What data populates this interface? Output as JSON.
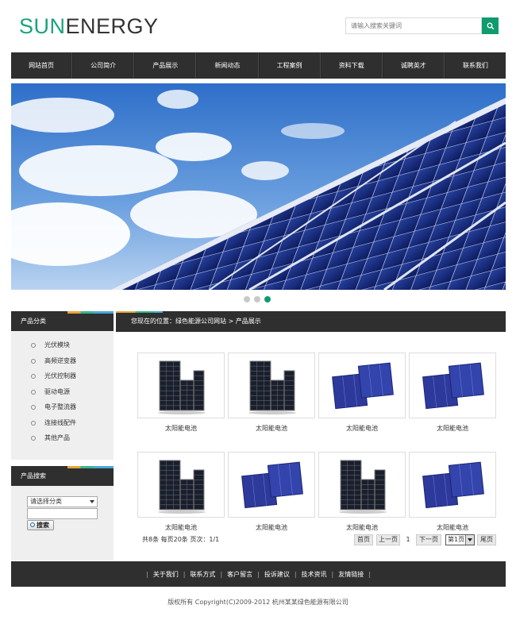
{
  "logo": {
    "part1": "SUN",
    "part2": "ENERGY"
  },
  "search": {
    "placeholder": "请输入搜索关键词"
  },
  "nav": [
    "网站首页",
    "公司简介",
    "产品展示",
    "新闻动态",
    "工程案例",
    "资料下载",
    "诚聘英才",
    "联系我们"
  ],
  "carousel": {
    "slides": 3,
    "active": 3
  },
  "sidebar": {
    "categories_title": "产品分类",
    "categories": [
      "光伏模块",
      "高频逆变器",
      "光伏控制器",
      "驱动电源",
      "电子整流器",
      "连接线配件",
      "其他产品"
    ],
    "search_title": "产品搜索",
    "select_value": "请选择分类",
    "search_button": "搜索"
  },
  "breadcrumb": {
    "prefix": "您现在的位置：",
    "site": "绿色能源公司网站",
    "separator": " > ",
    "current": "产品展示"
  },
  "products": [
    {
      "name": "太阳能电池",
      "img": "panel-stack"
    },
    {
      "name": "太阳能电池",
      "img": "panel-stack"
    },
    {
      "name": "太阳能电池",
      "img": "cell-blue"
    },
    {
      "name": "太阳能电池",
      "img": "cell-blue"
    },
    {
      "name": "太阳能电池",
      "img": "panel-stack"
    },
    {
      "name": "太阳能电池",
      "img": "cell-blue"
    },
    {
      "name": "太阳能电池",
      "img": "panel-stack"
    },
    {
      "name": "太阳能电池",
      "img": "cell-blue"
    }
  ],
  "pagination": {
    "summary": "共8条  每页20条  页次：1/1",
    "first": "首页",
    "prev": "上一页",
    "current_page": "1",
    "next": "下一页",
    "select_value": "第1页",
    "last": "尾页"
  },
  "footer": {
    "links": [
      "关于我们",
      "联系方式",
      "客户留言",
      "投诉建议",
      "技术资讯",
      "友情链接"
    ],
    "copyright": "版权所有  Copyright(C)2009-2012 杭州某某绿色能源有限公司"
  },
  "colors": {
    "accent": "#0f9b6e",
    "dark": "#2f2f2f",
    "sidebar_bg": "#efefef"
  }
}
